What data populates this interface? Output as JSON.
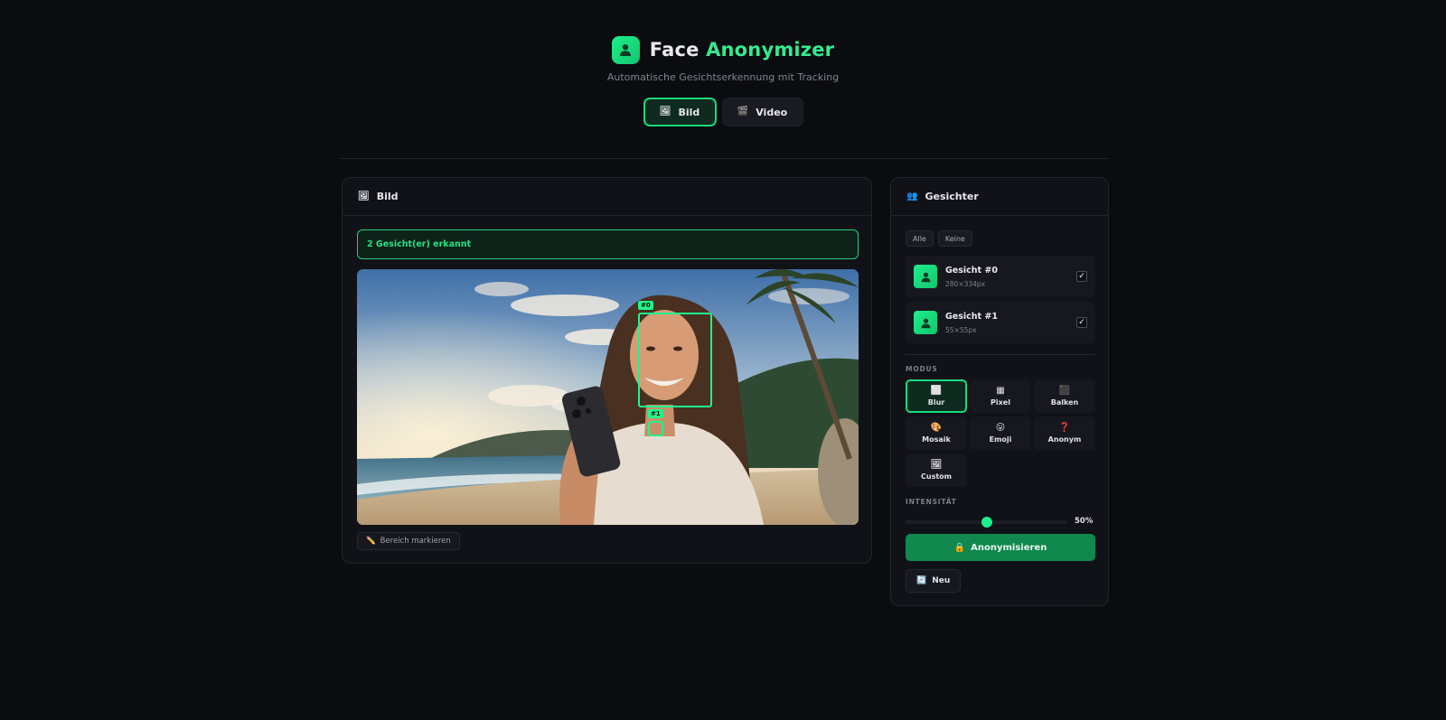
{
  "app": {
    "title_main": "Face",
    "title_accent": "Anonymizer",
    "subtitle": "Automatische Gesichtserkennung mit Tracking",
    "brand_color": "#1ef08a"
  },
  "tabs": [
    {
      "icon": "🖼",
      "label": "Bild",
      "active": true
    },
    {
      "icon": "🎬",
      "label": "Video",
      "active": false
    }
  ],
  "image_panel": {
    "icon": "🖼",
    "title": "Bild",
    "detection_status": "2 Gesicht(er) erkannt",
    "face_tags": [
      "#0",
      "#1"
    ],
    "mark_area_icon": "✏️",
    "mark_area_label": "Bereich markieren"
  },
  "faces_panel": {
    "icon": "👥",
    "title": "Gesichter",
    "select_all": "Alle",
    "select_none": "Keine",
    "faces": [
      {
        "name": "Gesicht #0",
        "size": "280×334px",
        "checked": "✓"
      },
      {
        "name": "Gesicht #1",
        "size": "55×55px",
        "checked": "✓"
      }
    ],
    "mode_label": "MODUS",
    "modes": [
      {
        "icon": "⬜",
        "label": "Blur",
        "active": true
      },
      {
        "icon": "▦",
        "label": "Pixel",
        "active": false
      },
      {
        "icon": "⬛",
        "label": "Balken",
        "active": false
      },
      {
        "icon": "🎨",
        "label": "Mosaik",
        "active": false
      },
      {
        "icon": "😛",
        "label": "Emoji",
        "active": false
      },
      {
        "icon": "❓",
        "label": "Anonym",
        "active": false
      },
      {
        "icon": "🖼",
        "label": "Custom",
        "active": false
      }
    ],
    "intensity_label": "INTENSITÄT",
    "intensity_value": "50%",
    "intensity_fraction": 0.5,
    "anonymize_icon": "🔒",
    "anonymize_label": "Anonymisieren",
    "new_icon": "🔄",
    "new_label": "Neu"
  }
}
